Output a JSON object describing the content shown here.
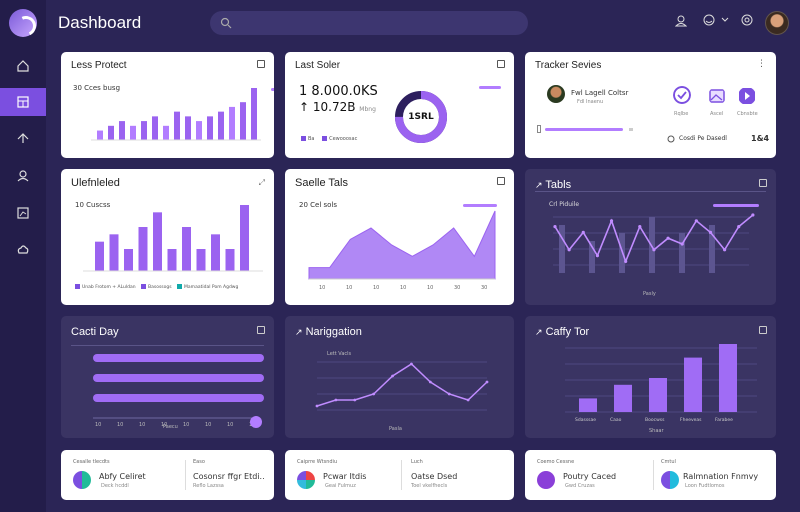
{
  "app": {
    "title": "Dashboard"
  },
  "sidebar": {
    "items": [
      {
        "icon": "home-icon"
      },
      {
        "icon": "dashboard-icon"
      },
      {
        "icon": "upload-icon"
      },
      {
        "icon": "user-icon"
      },
      {
        "icon": "chart-icon"
      },
      {
        "icon": "cloud-icon"
      }
    ]
  },
  "header": {
    "search": {
      "placeholder": ""
    }
  },
  "cards": {
    "c1": {
      "title": "Less Protect",
      "subtitle": "30 Cces busg",
      "chart_values": [
        2,
        3,
        4,
        3,
        4,
        5,
        3,
        6,
        5,
        4,
        5,
        6,
        7,
        8,
        11
      ]
    },
    "c2": {
      "title": "Last Soler",
      "value1": "8.000.0KS",
      "value2": "10.72B",
      "value2_suffix": "Mbng",
      "donut_label": "1SRL",
      "donut_percent": 75,
      "legend": [
        "Ba",
        "Cewooosac"
      ]
    },
    "c3": {
      "title": "Tracker Sevies",
      "item_title": "Fwl Lagell Coltsr",
      "item_sub": "Fdl Inaenu",
      "icons": [
        {
          "icon": "check-icon",
          "label": "Rqlbe"
        },
        {
          "icon": "image-icon",
          "label": "Ascel"
        },
        {
          "icon": "video-icon",
          "label": "Cbnsbte"
        }
      ],
      "footer": "Cosdi Pe Dasedl",
      "footer_value": "1&4"
    },
    "c4": {
      "title": "Ulefnleled",
      "subtitle": "10 Cuscss",
      "chart_values": [
        4,
        5,
        3,
        6,
        8,
        3,
        6,
        3,
        5,
        3,
        9
      ],
      "legend": [
        "Unab Frotom + ALuldan",
        "Basossogs",
        "Mamaatidal Pom Agdwg"
      ]
    },
    "c5": {
      "title": "Saelle Tals",
      "subtitle": "20 Cel sols",
      "x_ticks": [
        "10",
        "10",
        "10",
        "10",
        "10",
        "30",
        "30"
      ],
      "area_values": [
        2,
        2,
        7,
        9,
        6,
        4,
        6,
        9,
        4,
        12
      ]
    },
    "c6": {
      "title": "Tabls",
      "subtitle": "Crl Piduile",
      "line_values": [
        8,
        4,
        7,
        3,
        9,
        2,
        8,
        4,
        6,
        5,
        9,
        7,
        4,
        8,
        10
      ],
      "bar_values": [
        6,
        4,
        5,
        7,
        5,
        6
      ],
      "footer": "Pasly"
    },
    "c7": {
      "title": "Cacti Day",
      "bars": [
        100,
        100,
        100
      ],
      "x_ticks": [
        "10",
        "10",
        "10",
        "10",
        "10",
        "10",
        "10",
        "10"
      ],
      "footer": "Paecu"
    },
    "c8": {
      "title": "Nariggation",
      "subtitle": "Lett Vacls",
      "line_values": [
        1,
        2,
        2,
        3,
        6,
        8,
        5,
        3,
        2,
        5
      ],
      "footer": "Pasla"
    },
    "c9": {
      "title": "Caffy Tor",
      "bar_values": [
        2,
        4,
        5,
        8,
        10
      ],
      "x_labels": [
        "Sdasssae",
        "Caao",
        "Boocwss",
        "Fheeveas",
        "Farabee"
      ],
      "footer": "Shaar"
    },
    "b1": {
      "title": "Cesalle tlecdts",
      "left_name": "Abfy Celiret",
      "left_sub": "Deck hcddl",
      "right_label": "Easo",
      "right_name": "Cosonsr ffgr Etdi..",
      "right_sub": "Reflo Lazssa"
    },
    "b2": {
      "title": "Caiprre Wtsndiu",
      "left_name": "Pcwar Itdis",
      "left_sub": "Geai Fulmuz",
      "right_label": "Luch",
      "right_name": "Oatse Dsed",
      "right_sub": "Toel vkelfhecls"
    },
    "b3": {
      "title": "Coemo Cessne",
      "left_name": "Poutry Caced",
      "left_sub": "Gwd Cruzas",
      "right_label": "Cmtul",
      "right_name": "Ralmnation Fnmvy",
      "right_sub": "Loon Fudtlomos"
    }
  }
}
